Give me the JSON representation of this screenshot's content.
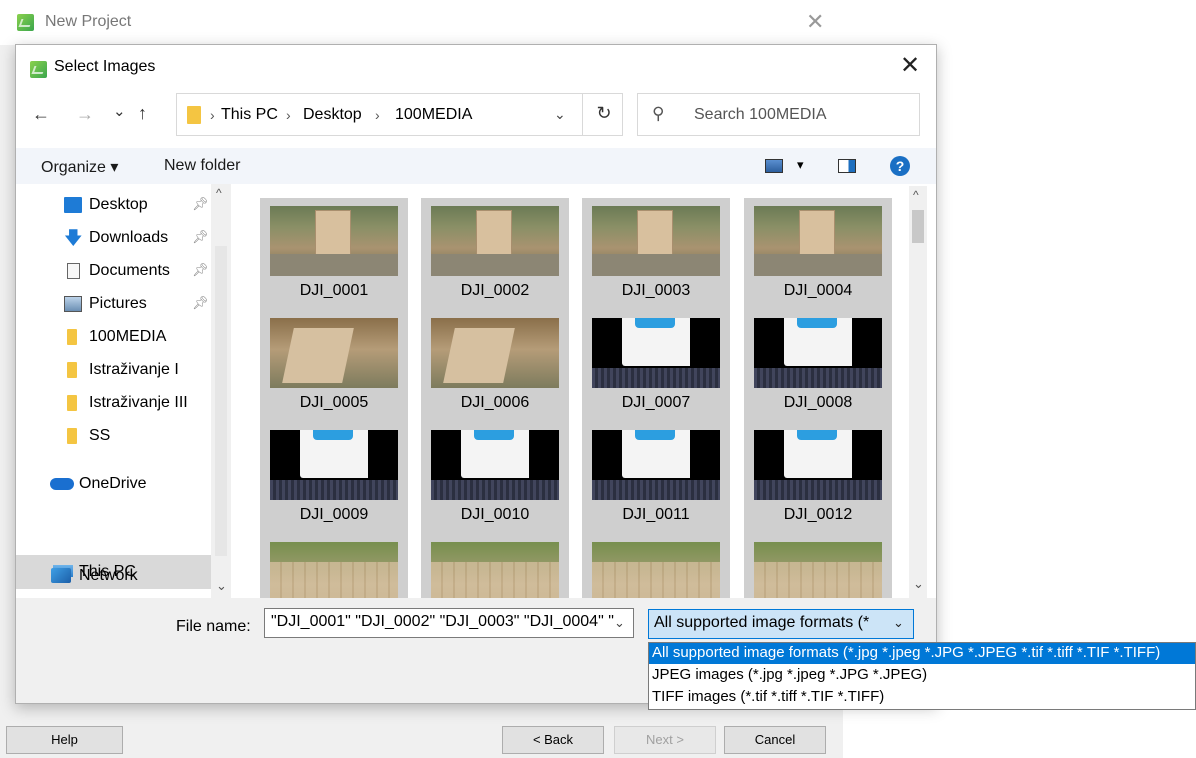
{
  "outer_window": {
    "title": "New Project",
    "close_glyph": "✕"
  },
  "dialog": {
    "title": "Select Images",
    "close_glyph": "✕",
    "nav": {
      "back": "←",
      "forward": "→",
      "recent": "⌄",
      "up": "↑",
      "refresh": "↻"
    },
    "breadcrumb": [
      "This PC",
      "Desktop",
      "100MEDIA"
    ],
    "breadcrumb_sep": "›",
    "search_placeholder": "Search 100MEDIA",
    "toolbar": {
      "organize": "Organize ▾",
      "new_folder": "New folder",
      "view_menu": "▾",
      "help_glyph": "?"
    },
    "sidebar": [
      {
        "label": "Desktop",
        "icon": "desktop-icon",
        "pinned": true
      },
      {
        "label": "Downloads",
        "icon": "download-icon",
        "pinned": true
      },
      {
        "label": "Documents",
        "icon": "document-icon",
        "pinned": true
      },
      {
        "label": "Pictures",
        "icon": "pictures-icon",
        "pinned": true
      },
      {
        "label": "100MEDIA",
        "icon": "folder-icon",
        "pinned": false
      },
      {
        "label": "Istraživanje I",
        "icon": "folder-icon",
        "pinned": false
      },
      {
        "label": "Istraživanje III",
        "icon": "folder-icon",
        "pinned": false
      },
      {
        "label": "SS",
        "icon": "folder-icon",
        "pinned": false
      },
      {
        "label": "OneDrive",
        "icon": "onedrive-icon",
        "pinned": false
      },
      {
        "label": "This PC",
        "icon": "pc-icon",
        "pinned": false,
        "selected": true
      },
      {
        "label": "Network",
        "icon": "network-icon",
        "pinned": false
      }
    ],
    "files": [
      {
        "name": "DJI_0001",
        "thumb": "tower"
      },
      {
        "name": "DJI_0002",
        "thumb": "tower"
      },
      {
        "name": "DJI_0003",
        "thumb": "tower"
      },
      {
        "name": "DJI_0004",
        "thumb": "tower"
      },
      {
        "name": "DJI_0005",
        "thumb": "wall"
      },
      {
        "name": "DJI_0006",
        "thumb": "wall"
      },
      {
        "name": "DJI_0007",
        "thumb": "doc"
      },
      {
        "name": "DJI_0008",
        "thumb": "doc"
      },
      {
        "name": "DJI_0009",
        "thumb": "doc"
      },
      {
        "name": "DJI_0010",
        "thumb": "doc"
      },
      {
        "name": "DJI_0011",
        "thumb": "doc"
      },
      {
        "name": "DJI_0012",
        "thumb": "doc"
      },
      {
        "name": "",
        "thumb": "ridge"
      },
      {
        "name": "",
        "thumb": "ridge"
      },
      {
        "name": "",
        "thumb": "ridge"
      },
      {
        "name": "",
        "thumb": "ridge"
      }
    ],
    "file_name_label": "File name:",
    "file_name_value": "\"DJI_0001\" \"DJI_0002\" \"DJI_0003\" \"DJI_0004\" \"",
    "file_type_selected": "All supported image formats (*",
    "file_type_options": [
      "All supported image formats (*.jpg *.jpeg *.JPG *.JPEG *.tif *.tiff *.TIF *.TIFF)",
      "JPEG images (*.jpg *.jpeg *.JPG *.JPEG)",
      "TIFF images (*.tif *.tiff *.TIF *.TIFF)"
    ]
  },
  "wizard_buttons": {
    "help": "Help",
    "back": "< Back",
    "next": "Next >",
    "cancel": "Cancel"
  }
}
